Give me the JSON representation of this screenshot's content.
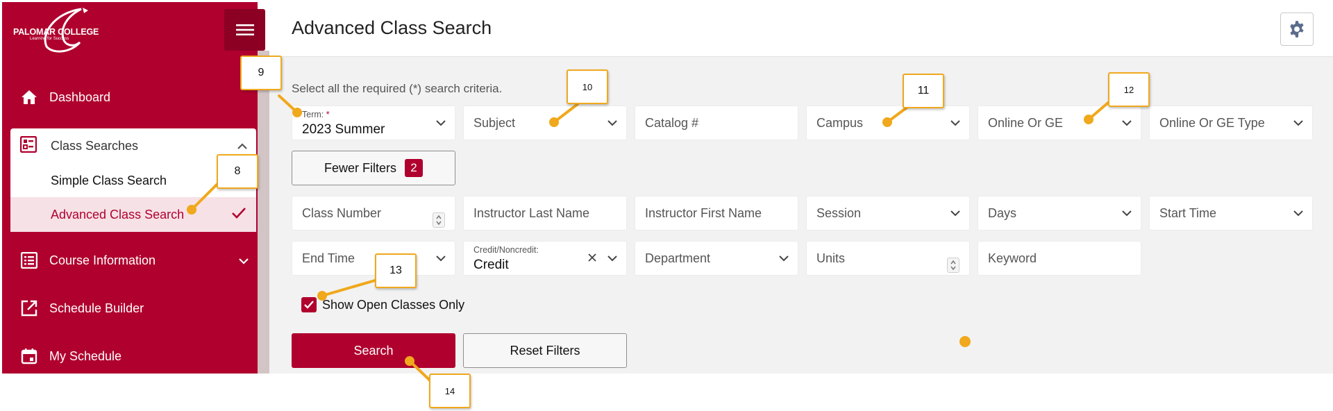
{
  "sidebar": {
    "logo_text": "PALOMAR COLLEGE",
    "logo_subtext": "Learning for Success",
    "menu_icon": "hamburger-icon",
    "items": [
      {
        "label": "Dashboard",
        "icon": "home-icon"
      },
      {
        "label": "Class Searches",
        "icon": "list-search-icon",
        "expanded": true,
        "children": [
          {
            "label": "Simple Class Search"
          },
          {
            "label": "Advanced Class Search",
            "active": true
          }
        ]
      },
      {
        "label": "Course Information",
        "icon": "list-icon"
      },
      {
        "label": "Schedule Builder",
        "icon": "external-link-icon"
      },
      {
        "label": "My Schedule",
        "icon": "calendar-icon"
      }
    ]
  },
  "header": {
    "title": "Advanced Class Search",
    "settings_icon": "gear-icon"
  },
  "main": {
    "hint": "Select all the required (*) search criteria.",
    "term": {
      "label": "Term:",
      "required_mark": "*",
      "value": "2023 Summer"
    },
    "row1": {
      "subject": "Subject",
      "catalog": "Catalog #",
      "campus": "Campus",
      "online_ge": "Online Or GE",
      "online_ge_type": "Online Or GE Type"
    },
    "fewer_filters": {
      "label": "Fewer Filters",
      "count": "2"
    },
    "row2": {
      "class_number": "Class Number",
      "instructor_last": "Instructor Last Name",
      "instructor_first": "Instructor First Name",
      "session": "Session",
      "days": "Days",
      "start_time": "Start Time"
    },
    "row3": {
      "end_time": "End Time",
      "credit": {
        "label": "Credit/Noncredit:",
        "value": "Credit"
      },
      "department": "Department",
      "units": "Units",
      "keyword": "Keyword"
    },
    "open_only": {
      "label": "Show Open Classes Only",
      "checked": true
    },
    "search_label": "Search",
    "reset_label": "Reset Filters"
  },
  "callouts": [
    "8",
    "9",
    "10",
    "11",
    "12",
    "13",
    "14"
  ],
  "colors": {
    "brand": "#b0002e",
    "callout_border": "#f0a81c"
  }
}
